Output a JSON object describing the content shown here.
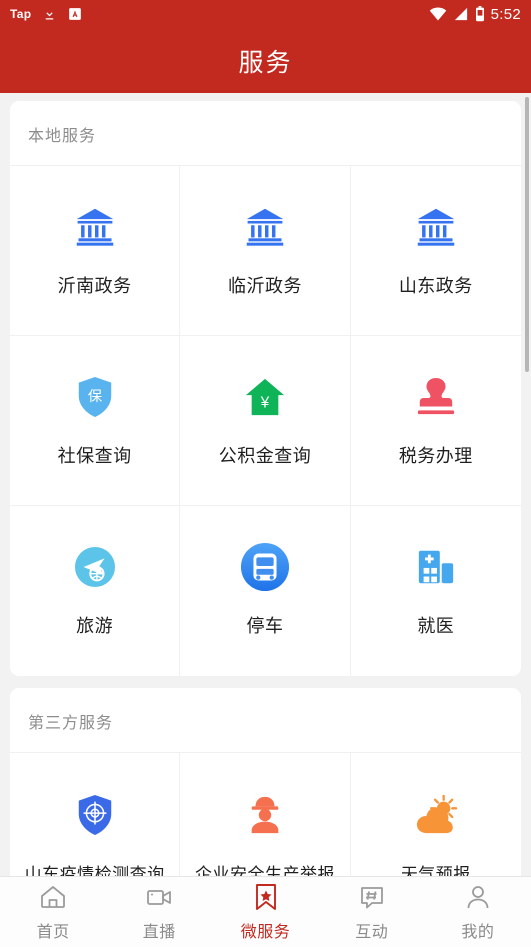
{
  "statusbar": {
    "left_label": "Tap",
    "download_icon": "download-icon",
    "app_badge_icon": "letter-a-badge-icon",
    "wifi_icon": "wifi-icon",
    "signal_icon": "cellular-signal-icon",
    "battery_icon": "battery-icon",
    "time": "5:52"
  },
  "header": {
    "title": "服务",
    "background": "#c2291f"
  },
  "sections": [
    {
      "title": "本地服务",
      "items": [
        {
          "label": "沂南政务",
          "icon": "government-building-icon",
          "color": "#3573f0"
        },
        {
          "label": "临沂政务",
          "icon": "government-building-icon",
          "color": "#3573f0"
        },
        {
          "label": "山东政务",
          "icon": "government-building-icon",
          "color": "#3573f0"
        },
        {
          "label": "社保查询",
          "icon": "shield-insurance-icon",
          "color": "#58b3ee"
        },
        {
          "label": "公积金查询",
          "icon": "house-yuan-icon",
          "color": "#0fb458"
        },
        {
          "label": "税务办理",
          "icon": "rubber-stamp-icon",
          "color": "#ef5363"
        },
        {
          "label": "旅游",
          "icon": "airplane-globe-icon",
          "color": "#5cc4e8"
        },
        {
          "label": "停车",
          "icon": "bus-circle-icon",
          "color": "#2f8ef4"
        },
        {
          "label": "就医",
          "icon": "hospital-building-icon",
          "color": "#45a8ef"
        }
      ]
    },
    {
      "title": "第三方服务",
      "items": [
        {
          "label": "山东疫情检测查询",
          "icon": "shield-target-icon",
          "color": "#3a6ae8"
        },
        {
          "label": "企业安全生产举报",
          "icon": "worker-helmet-icon",
          "color": "#f5704f"
        },
        {
          "label": "天气预报",
          "icon": "sun-cloud-icon",
          "color": "#f79438"
        }
      ]
    }
  ],
  "tabbar": {
    "items": [
      {
        "label": "首页",
        "icon": "home-icon",
        "active": false
      },
      {
        "label": "直播",
        "icon": "video-camera-icon",
        "active": false
      },
      {
        "label": "微服务",
        "icon": "bookmark-star-icon",
        "active": true
      },
      {
        "label": "互动",
        "icon": "hash-chat-bubble-icon",
        "active": false
      },
      {
        "label": "我的",
        "icon": "person-icon",
        "active": false
      }
    ],
    "active_color": "#c2291f",
    "inactive_color": "#8a8a8a"
  }
}
